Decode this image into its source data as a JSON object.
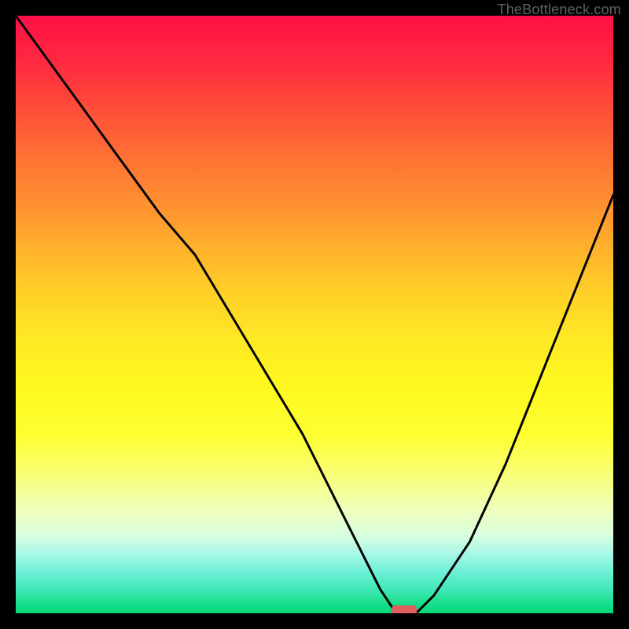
{
  "watermark": "TheBottleneck.com",
  "chart_data": {
    "type": "line",
    "title": "",
    "xlabel": "",
    "ylabel": "",
    "xlim": [
      0,
      100
    ],
    "ylim": [
      0,
      100
    ],
    "grid": false,
    "series": [
      {
        "name": "bottleneck-curve",
        "x": [
          0,
          8,
          16,
          24,
          30,
          36,
          42,
          48,
          53,
          58,
          61,
          63,
          65,
          67,
          70,
          76,
          82,
          88,
          94,
          100
        ],
        "values": [
          100,
          89,
          78,
          67,
          60,
          50,
          40,
          30,
          20,
          10,
          4,
          1,
          0,
          0,
          3,
          12,
          25,
          40,
          55,
          70
        ]
      }
    ],
    "marker": {
      "x": 65,
      "y": 0,
      "color": "#e06060"
    },
    "background_gradient": {
      "type": "vertical",
      "stops": [
        {
          "pos": 0.0,
          "color": "#ff1048"
        },
        {
          "pos": 0.3,
          "color": "#ff8a30"
        },
        {
          "pos": 0.6,
          "color": "#fff820"
        },
        {
          "pos": 0.85,
          "color": "#eeffc0"
        },
        {
          "pos": 1.0,
          "color": "#00d878"
        }
      ]
    }
  }
}
